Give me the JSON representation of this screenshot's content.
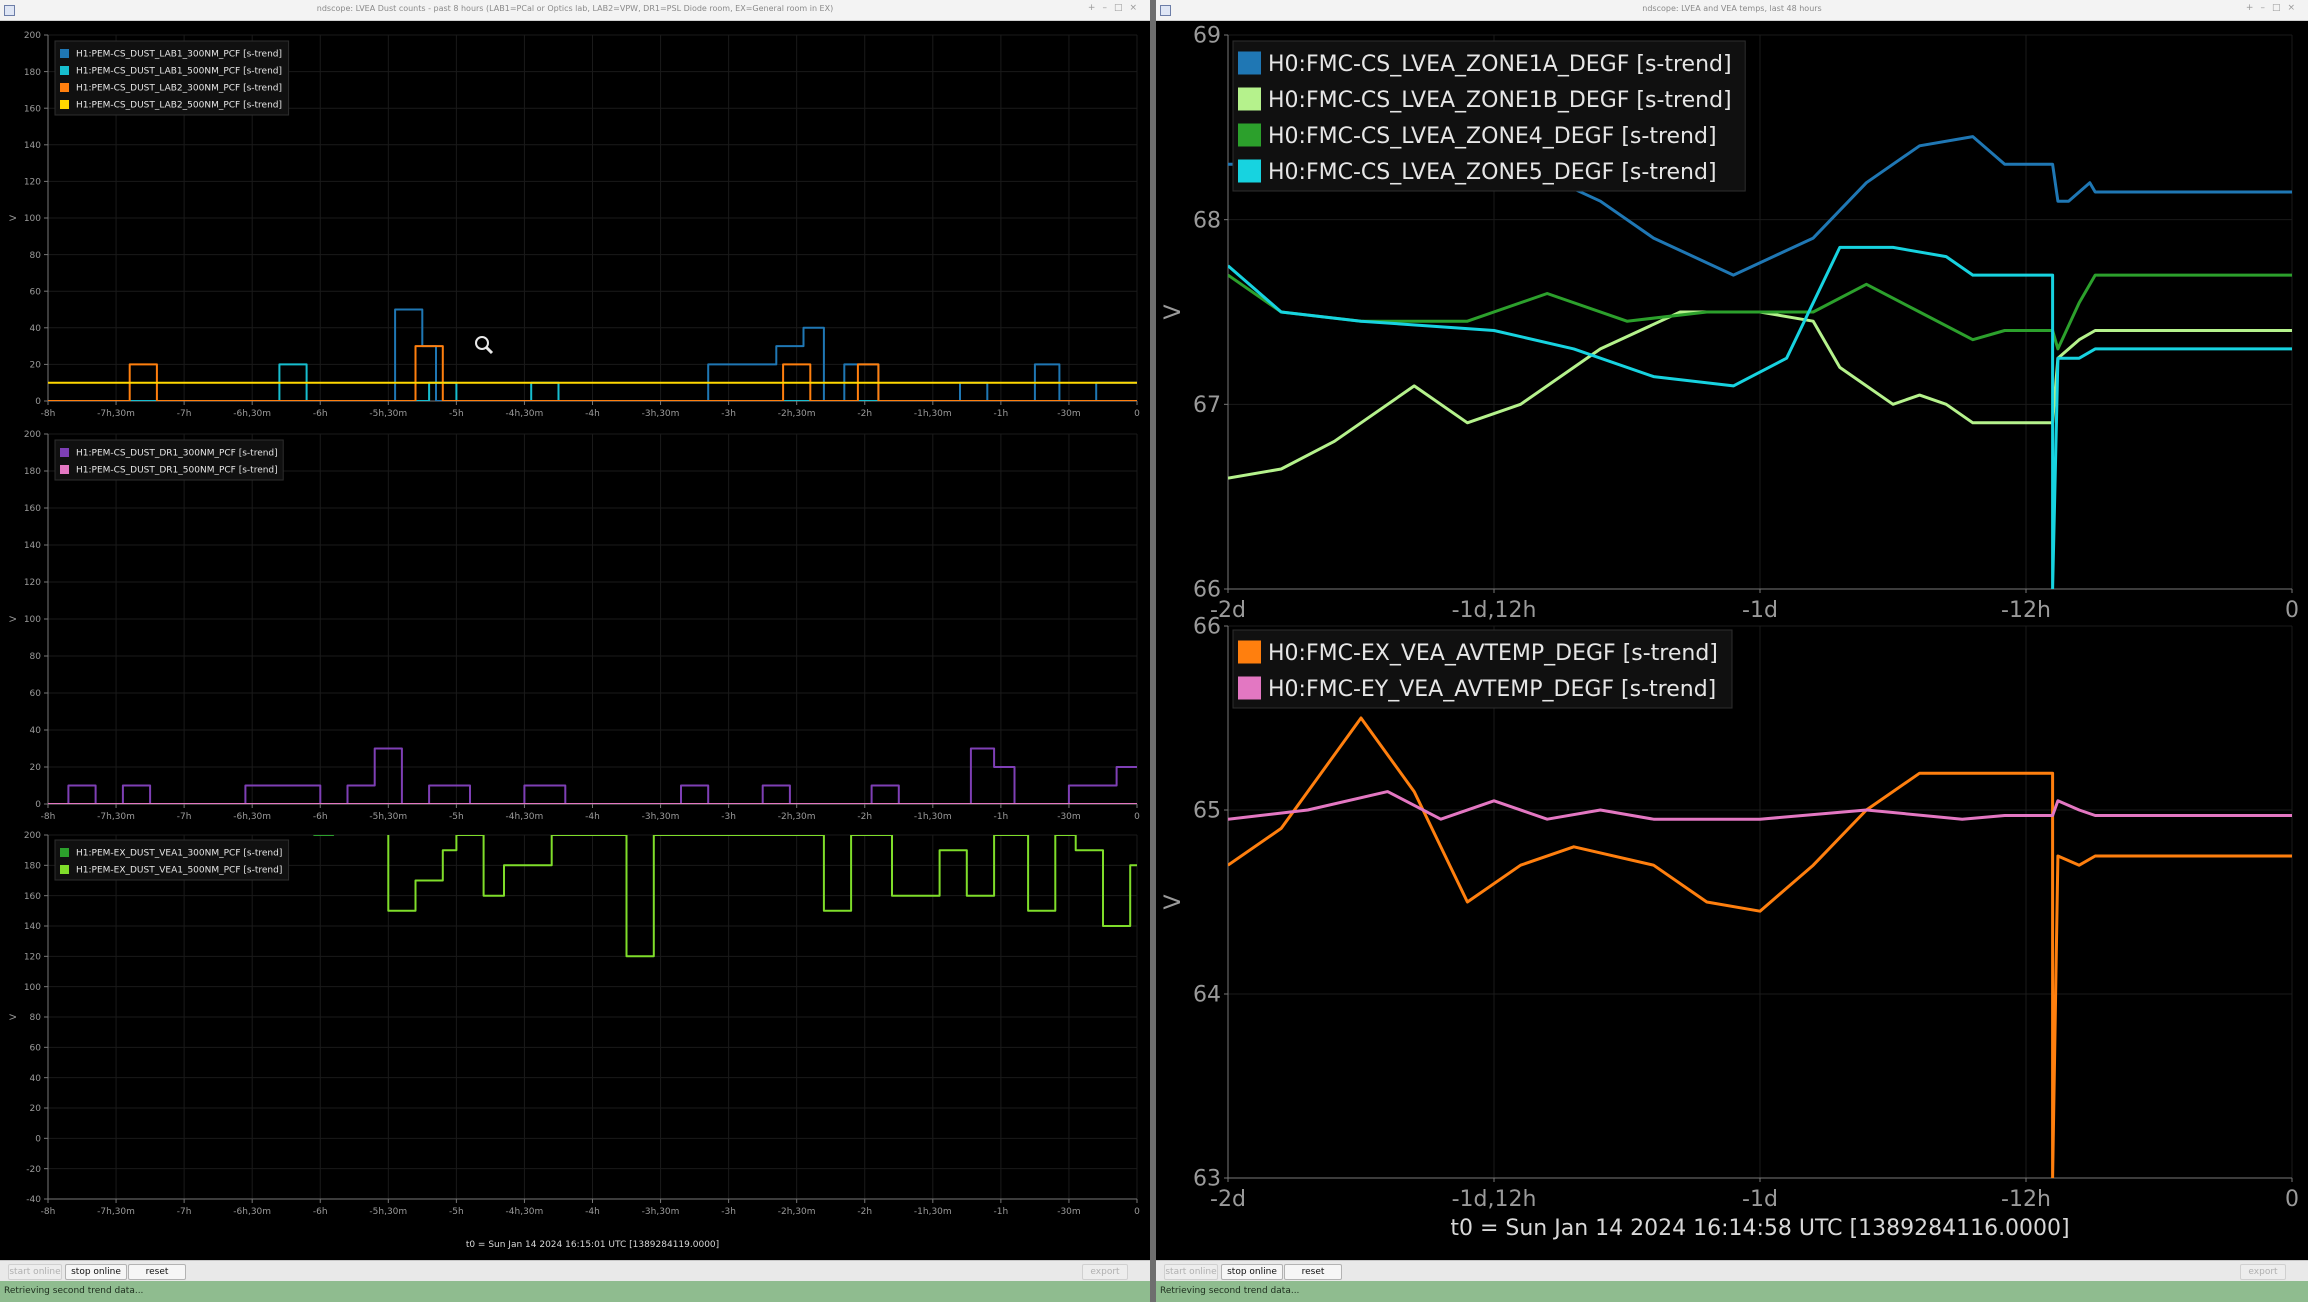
{
  "left_window": {
    "title": "ndscope: LVEA Dust counts - past 8 hours (LAB1=PCal or Optics lab, LAB2=VPW, DR1=PSL Diode room, EX=General room in EX)",
    "t0_label": "t0 = Sun Jan 14 2024 16:15:01 UTC [1389284119.0000]",
    "toolbar": {
      "left_disabled": "start online",
      "stop_online": "stop online",
      "reset": "reset",
      "right_disabled": "export"
    },
    "status": "Retrieving second trend data..."
  },
  "right_window": {
    "title": "ndscope: LVEA and VEA temps, last 48 hours",
    "t0_label": "t0 = Sun Jan 14 2024 16:14:58 UTC [1389284116.0000]",
    "toolbar": {
      "left_disabled": "start online",
      "stop_online": "stop online",
      "reset": "reset",
      "right_disabled": "export"
    },
    "status": "Retrieving second trend data..."
  },
  "chart_data": [
    {
      "type": "line",
      "step": true,
      "ylabel": "V",
      "ylim": [
        0,
        200
      ],
      "yticks": [
        "0",
        "20",
        "40",
        "60",
        "80",
        "100",
        "120",
        "140",
        "160",
        "180",
        "200"
      ],
      "xlim": [
        -8,
        0
      ],
      "xticks": [
        "-8h",
        "-7h,30m",
        "-7h",
        "-6h,30m",
        "-6h",
        "-5h,30m",
        "-5h",
        "-4h,30m",
        "-4h",
        "-3h,30m",
        "-3h",
        "-2h,30m",
        "-2h",
        "-1h,30m",
        "-1h",
        "-30m",
        "0"
      ],
      "series": [
        {
          "name": "H1:PEM-CS_DUST_LAB1_300NM_PCF [s-trend]",
          "color": "#1f77b4",
          "x": [
            -8,
            -5.45,
            -5.45,
            -5.25,
            -5.25,
            -5.15,
            -5.15,
            -3.15,
            -3.15,
            -2.65,
            -2.65,
            -2.45,
            -2.45,
            -2.3,
            -2.3,
            -2.15,
            -2.15,
            -1.9,
            -1.9,
            -1.3,
            -1.3,
            -1.1,
            -1.1,
            -0.75,
            -0.75,
            -0.57,
            -0.57,
            -0.3,
            -0.3,
            0
          ],
          "y": [
            0,
            0,
            50,
            50,
            30,
            30,
            0,
            0,
            20,
            20,
            30,
            30,
            40,
            40,
            0,
            0,
            20,
            20,
            0,
            0,
            10,
            10,
            0,
            0,
            20,
            20,
            0,
            0,
            10,
            10
          ]
        },
        {
          "name": "H1:PEM-CS_DUST_LAB1_500NM_PCF [s-trend]",
          "color": "#17becf",
          "x": [
            -8,
            -6.3,
            -6.3,
            -6.1,
            -6.1,
            -5.2,
            -5.2,
            -5,
            -5,
            -4.45,
            -4.45,
            -4.25,
            -4.25,
            0
          ],
          "y": [
            0,
            0,
            20,
            20,
            0,
            0,
            10,
            10,
            0,
            0,
            10,
            10,
            0,
            0
          ]
        },
        {
          "name": "H1:PEM-CS_DUST_LAB2_300NM_PCF [s-trend]",
          "color": "#ff7f0e",
          "x": [
            -8,
            -7.4,
            -7.4,
            -7.2,
            -7.2,
            -5.3,
            -5.3,
            -5.1,
            -5.1,
            -2.6,
            -2.6,
            -2.4,
            -2.4,
            -2.05,
            -2.05,
            -1.9,
            -1.9,
            0
          ],
          "y": [
            0,
            0,
            20,
            20,
            0,
            0,
            30,
            30,
            0,
            0,
            20,
            20,
            0,
            0,
            20,
            20,
            0,
            0
          ]
        },
        {
          "name": "H1:PEM-CS_DUST_LAB2_500NM_PCF [s-trend]",
          "color": "#ffd700",
          "x": [
            -8,
            0
          ],
          "y": [
            10,
            10
          ]
        }
      ]
    },
    {
      "type": "line",
      "step": true,
      "ylabel": "V",
      "ylim": [
        0,
        200
      ],
      "yticks": [
        "0",
        "20",
        "40",
        "60",
        "80",
        "100",
        "120",
        "140",
        "160",
        "180",
        "200"
      ],
      "xlim": [
        -8,
        0
      ],
      "xticks": [
        "-8h",
        "-7h,30m",
        "-7h",
        "-6h,30m",
        "-6h",
        "-5h,30m",
        "-5h",
        "-4h,30m",
        "-4h",
        "-3h,30m",
        "-3h",
        "-2h,30m",
        "-2h",
        "-1h,30m",
        "-1h",
        "-30m",
        "0"
      ],
      "series": [
        {
          "name": "H1:PEM-CS_DUST_DR1_300NM_PCF [s-trend]",
          "color": "#7e3fb5",
          "x": [
            -8,
            -7.85,
            -7.85,
            -7.65,
            -7.65,
            -7.45,
            -7.45,
            -7.25,
            -7.25,
            -6.55,
            -6.55,
            -6,
            -6,
            -5.8,
            -5.8,
            -5.6,
            -5.6,
            -5.4,
            -5.4,
            -5.2,
            -5.2,
            -4.9,
            -4.9,
            -4.5,
            -4.5,
            -4.2,
            -4.2,
            -4,
            -4,
            -3.35,
            -3.35,
            -3.15,
            -3.15,
            -2.75,
            -2.75,
            -2.55,
            -2.55,
            -1.95,
            -1.95,
            -1.75,
            -1.75,
            -1.22,
            -1.22,
            -1.05,
            -1.05,
            -0.9,
            -0.9,
            -0.5,
            -0.5,
            -0.15,
            -0.15,
            0
          ],
          "y": [
            0,
            0,
            10,
            10,
            0,
            0,
            10,
            10,
            0,
            0,
            10,
            10,
            0,
            0,
            10,
            10,
            30,
            30,
            0,
            0,
            10,
            10,
            0,
            0,
            10,
            10,
            0,
            0,
            0,
            0,
            10,
            10,
            0,
            0,
            10,
            10,
            0,
            0,
            10,
            10,
            0,
            0,
            30,
            30,
            20,
            20,
            0,
            0,
            10,
            10,
            20,
            20
          ]
        },
        {
          "name": "H1:PEM-CS_DUST_DR1_500NM_PCF [s-trend]",
          "color": "#e377c2",
          "x": [
            -8,
            0
          ],
          "y": [
            0,
            0
          ]
        }
      ]
    },
    {
      "type": "line",
      "step": true,
      "ylabel": "V",
      "ylim": [
        -40,
        200
      ],
      "yticks": [
        "-40",
        "-20",
        "0",
        "20",
        "40",
        "60",
        "80",
        "100",
        "120",
        "140",
        "160",
        "180",
        "200"
      ],
      "xlim": [
        -8,
        0
      ],
      "xticks": [
        "-8h",
        "-7h,30m",
        "-7h",
        "-6h,30m",
        "-6h",
        "-5h,30m",
        "-5h",
        "-4h,30m",
        "-4h",
        "-3h,30m",
        "-3h",
        "-2h,30m",
        "-2h",
        "-1h,30m",
        "-1h",
        "-30m",
        "0"
      ],
      "series": [
        {
          "name": "H1:PEM-EX_DUST_VEA1_300NM_PCF [s-trend]",
          "color": "#2ca02c",
          "x": [
            -6.05,
            -5.9,
            -5.9,
            -3.35,
            -3.35,
            -3.15
          ],
          "y": [
            200,
            200,
            null,
            null,
            200,
            200
          ]
        },
        {
          "name": "H1:PEM-EX_DUST_VEA1_500NM_PCF [s-trend]",
          "color": "#7fdd2a",
          "x": [
            -5.5,
            -5.5,
            -5.3,
            -5.3,
            -5.1,
            -5.1,
            -5,
            -5,
            -4.8,
            -4.8,
            -4.65,
            -4.65,
            -4.3,
            -4.3,
            -3.75,
            -3.75,
            -3.55,
            -3.55,
            -2.3,
            -2.3,
            -2.1,
            -2.1,
            -1.8,
            -1.8,
            -1.45,
            -1.45,
            -1.25,
            -1.25,
            -1.05,
            -1.05,
            -0.8,
            -0.8,
            -0.6,
            -0.6,
            -0.45,
            -0.45,
            -0.25,
            -0.25,
            -0.05,
            -0.05,
            0
          ],
          "y": [
            200,
            150,
            150,
            170,
            170,
            190,
            190,
            200,
            200,
            160,
            160,
            180,
            180,
            200,
            200,
            120,
            120,
            200,
            200,
            150,
            150,
            200,
            200,
            160,
            160,
            190,
            190,
            160,
            160,
            200,
            200,
            150,
            150,
            200,
            200,
            190,
            190,
            140,
            140,
            180,
            180
          ]
        }
      ]
    },
    {
      "type": "line",
      "ylabel": "V",
      "ylim": [
        66,
        69
      ],
      "yticks": [
        "66",
        "67",
        "68",
        "69"
      ],
      "xlim": [
        -2,
        0
      ],
      "xticks": [
        "-2d",
        "-1d,12h",
        "-1d",
        "-12h",
        "0"
      ],
      "series": [
        {
          "name": "H0:FMC-CS_LVEA_ZONE1A_DEGF [s-trend]",
          "color": "#1f77b4",
          "x": [
            -2,
            -1.8,
            -1.6,
            -1.45,
            -1.3,
            -1.2,
            -1.05,
            -0.9,
            -0.8,
            -0.7,
            -0.6,
            -0.54,
            -0.5,
            -0.45,
            -0.44,
            -0.42,
            -0.38,
            -0.37,
            0
          ],
          "y": [
            68.3,
            68.3,
            68.3,
            68.3,
            68.1,
            67.9,
            67.7,
            67.9,
            68.2,
            68.4,
            68.45,
            68.3,
            68.3,
            68.3,
            68.1,
            68.1,
            68.2,
            68.15,
            68.15
          ]
        },
        {
          "name": "H0:FMC-CS_LVEA_ZONE1B_DEGF [s-trend]",
          "color": "#b5f28c",
          "x": [
            -2,
            -1.9,
            -1.8,
            -1.65,
            -1.55,
            -1.45,
            -1.3,
            -1.15,
            -1.0,
            -0.9,
            -0.85,
            -0.75,
            -0.7,
            -0.65,
            -0.6,
            -0.54,
            -0.45,
            -0.44,
            -0.4,
            -0.37,
            0
          ],
          "y": [
            66.6,
            66.65,
            66.8,
            67.1,
            66.9,
            67.0,
            67.3,
            67.5,
            67.5,
            67.45,
            67.2,
            67.0,
            67.05,
            67.0,
            66.9,
            66.9,
            66.9,
            67.25,
            67.35,
            67.4,
            67.4
          ]
        },
        {
          "name": "H0:FMC-CS_LVEA_ZONE4_DEGF [s-trend]",
          "color": "#2ca02c",
          "x": [
            -2,
            -1.9,
            -1.75,
            -1.55,
            -1.4,
            -1.25,
            -1.1,
            -0.9,
            -0.8,
            -0.7,
            -0.6,
            -0.54,
            -0.45,
            -0.44,
            -0.4,
            -0.37,
            0
          ],
          "y": [
            67.7,
            67.5,
            67.45,
            67.45,
            67.6,
            67.45,
            67.5,
            67.5,
            67.65,
            67.5,
            67.35,
            67.4,
            67.4,
            67.3,
            67.55,
            67.7,
            67.7
          ]
        },
        {
          "name": "H0:FMC-CS_LVEA_ZONE5_DEGF [s-trend]",
          "color": "#17d3e0",
          "x": [
            -2,
            -1.9,
            -1.75,
            -1.5,
            -1.35,
            -1.2,
            -1.05,
            -0.95,
            -0.85,
            -0.75,
            -0.65,
            -0.6,
            -0.54,
            -0.45,
            -0.45,
            -0.44,
            -0.4,
            -0.37,
            0
          ],
          "y": [
            67.75,
            67.5,
            67.45,
            67.4,
            67.3,
            67.15,
            67.1,
            67.25,
            67.85,
            67.85,
            67.8,
            67.7,
            67.7,
            67.7,
            66,
            67.25,
            67.25,
            67.3,
            67.3
          ]
        }
      ]
    },
    {
      "type": "line",
      "ylabel": "V",
      "ylim": [
        63,
        66
      ],
      "yticks": [
        "63",
        "64",
        "65",
        "66"
      ],
      "xlim": [
        -2,
        0
      ],
      "xticks": [
        "-2d",
        "-1d,12h",
        "-1d",
        "-12h",
        "0"
      ],
      "series": [
        {
          "name": "H0:FMC-EX_VEA_AVTEMP_DEGF [s-trend]",
          "color": "#ff7f0e",
          "x": [
            -2,
            -1.9,
            -1.75,
            -1.65,
            -1.55,
            -1.45,
            -1.35,
            -1.2,
            -1.1,
            -1.0,
            -0.9,
            -0.8,
            -0.7,
            -0.62,
            -0.54,
            -0.45,
            -0.45,
            -0.44,
            -0.4,
            -0.37,
            0
          ],
          "y": [
            64.7,
            64.9,
            65.5,
            65.1,
            64.5,
            64.7,
            64.8,
            64.7,
            64.5,
            64.45,
            64.7,
            65.0,
            65.2,
            65.2,
            65.2,
            65.2,
            63,
            64.75,
            64.7,
            64.75,
            64.75
          ]
        },
        {
          "name": "H0:FMC-EY_VEA_AVTEMP_DEGF [s-trend]",
          "color": "#e377c2",
          "x": [
            -2,
            -1.85,
            -1.7,
            -1.6,
            -1.5,
            -1.4,
            -1.3,
            -1.2,
            -1.0,
            -0.8,
            -0.62,
            -0.54,
            -0.45,
            -0.44,
            -0.4,
            -0.37,
            0
          ],
          "y": [
            64.95,
            65.0,
            65.1,
            64.95,
            65.05,
            64.95,
            65.0,
            64.95,
            64.95,
            65.0,
            64.95,
            64.97,
            64.97,
            65.05,
            65.0,
            64.97,
            64.97
          ]
        }
      ]
    }
  ]
}
